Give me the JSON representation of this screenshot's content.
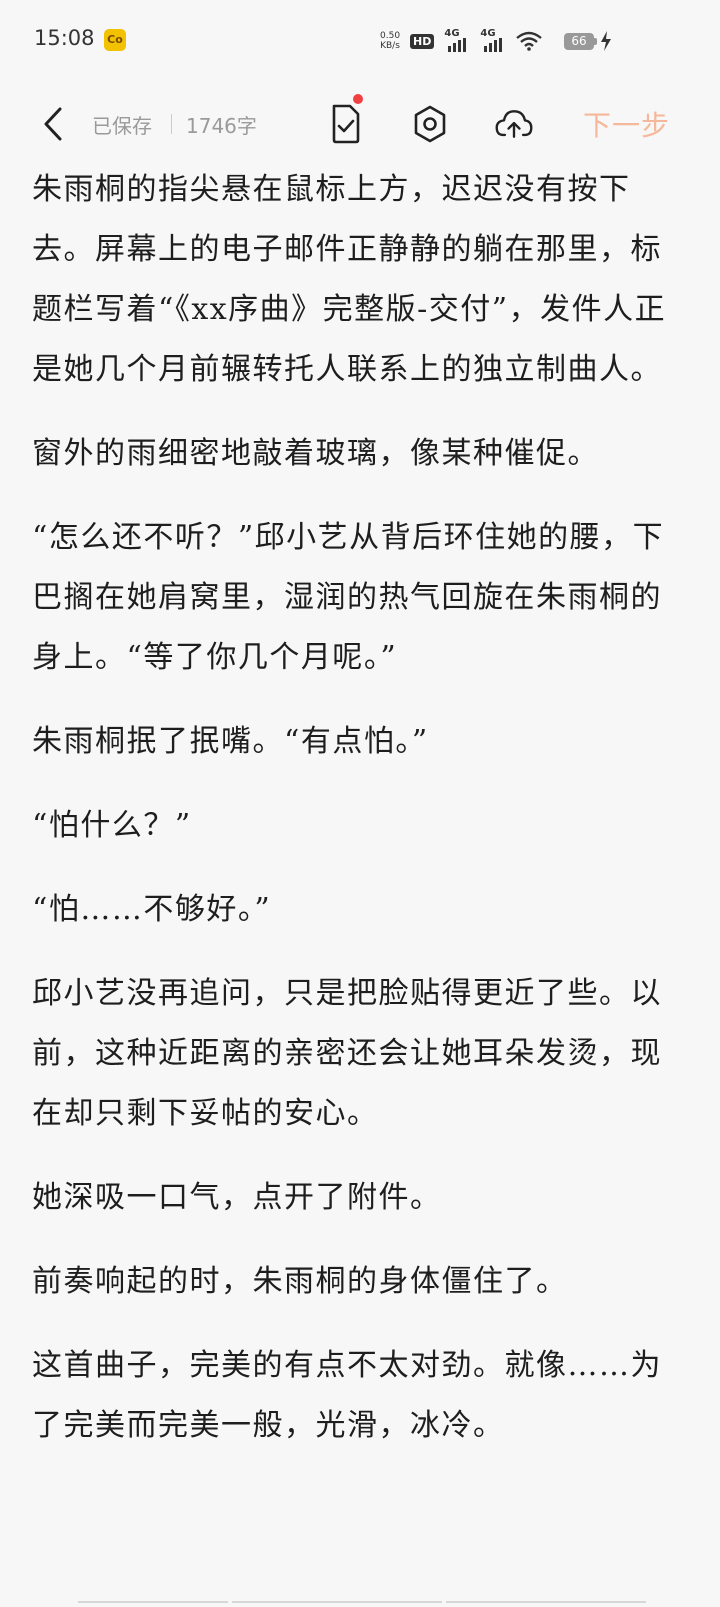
{
  "status_bar": {
    "time": "15:08",
    "app_icon_text": "Co",
    "net_speed_value": "0.50",
    "net_speed_unit": "KB/s",
    "hd_label": "HD",
    "sim1_type": "4G",
    "sim2_type": "4G",
    "battery_level": "66"
  },
  "toolbar": {
    "saved_label": "已保存",
    "word_count": "1746字",
    "next_label": "下一步",
    "accent_color": "#f6b89a",
    "badge_color": "#f04040"
  },
  "content": {
    "paragraphs": [
      "朱雨桐的指尖悬在鼠标上方，迟迟没有按下去。屏幕上的电子邮件正静静的躺在那里，标题栏写着“《xx序曲》完整版-交付”，发件人正是她几个月前辗转托人联系上的独立制曲人。",
      "窗外的雨细密地敲着玻璃，像某种催促。",
      "“怎么还不听？”邱小艺从背后环住她的腰，下巴搁在她肩窝里，湿润的热气回旋在朱雨桐的身上。“等了你几个月呢。”",
      "朱雨桐抿了抿嘴。“有点怕。”",
      "“怕什么？”",
      "“怕……不够好。”",
      "邱小艺没再追问，只是把脸贴得更近了些。以前，这种近距离的亲密还会让她耳朵发烫，现在却只剩下妥帖的安心。",
      "她深吸一口气，点开了附件。",
      "前奏响起的时，朱雨桐的身体僵住了。",
      "这首曲子，完美的有点不太对劲。就像……为了完美而完美一般，光滑，冰冷。"
    ]
  }
}
